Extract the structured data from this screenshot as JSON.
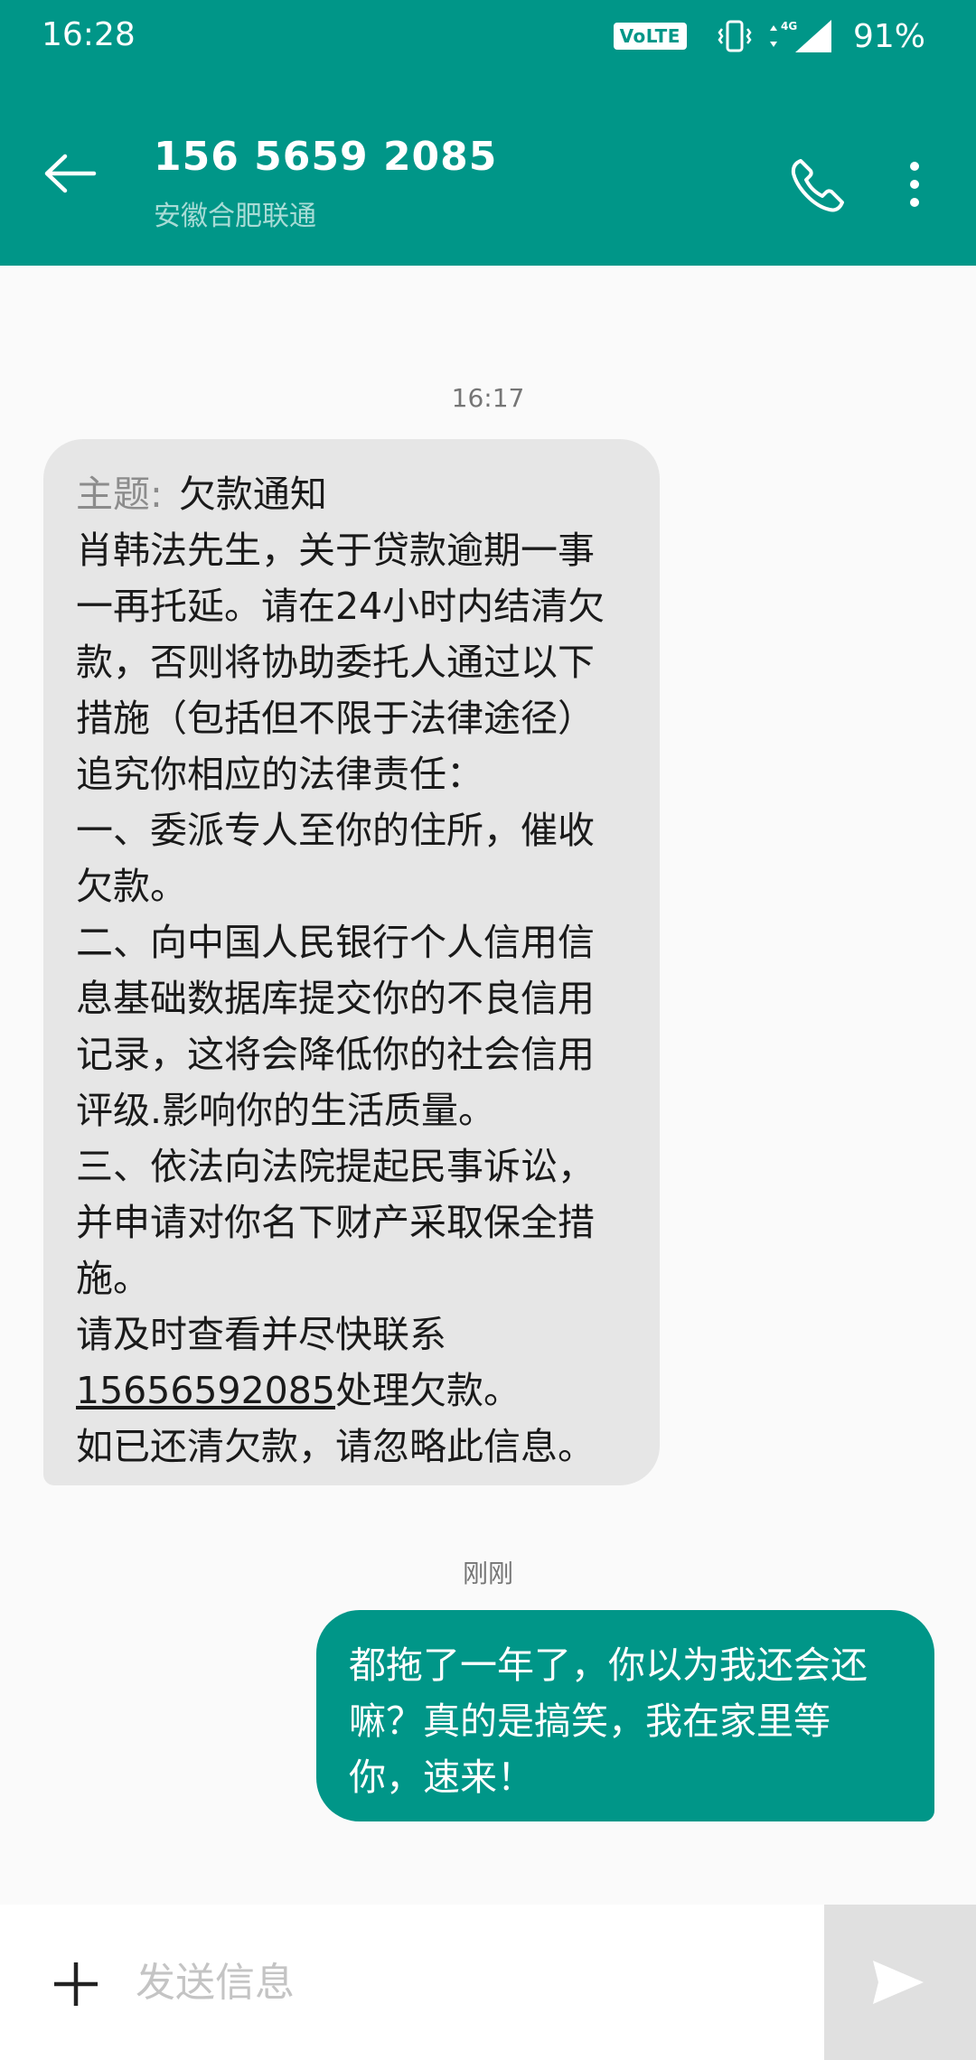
{
  "status_bar": {
    "time": "16:28",
    "volte_label": "VoLTE",
    "network_label": "4G",
    "battery": "91%"
  },
  "header": {
    "contact_name": "156 5659 2085",
    "contact_location": "安徽合肥联通"
  },
  "conversation": {
    "incoming": {
      "timestamp": "16:17",
      "subject_label": "主题:",
      "subject": "欠款通知",
      "lines": [
        "肖韩法先生，关于贷款逾期一事",
        "一再托延。请在24小时内结清欠",
        "款，否则将协助委托人通过以下",
        "措施（包括但不限于法律途径）",
        "追究你相应的法律责任：",
        "一、委派专人至你的住所，催收",
        "欠款。",
        "二、向中国人民银行个人信用信",
        "息基础数据库提交你的不良信用",
        "记录，这将会降低你的社会信用",
        "评级.影响你的生活质量。",
        "三、依法向法院提起民事诉讼，",
        "并申请对你名下财产采取保全措",
        "施。",
        "请及时查看并尽快联系"
      ],
      "phone_link": "15656592085",
      "after_link": "处理欠款。",
      "last_line": "如已还清欠款，请忽略此信息。"
    },
    "outgoing": {
      "timestamp": "刚刚",
      "lines": [
        "都拖了一年了，你以为我还会还",
        "嘛？真的是搞笑，我在家里等",
        "你，速来！"
      ]
    }
  },
  "compose": {
    "placeholder": "发送信息"
  },
  "colors": {
    "primary": "#009688",
    "incoming_bubble": "#e6e6e6",
    "send_area": "#e0e0e0"
  },
  "icons": [
    "back-arrow-icon",
    "phone-icon",
    "more-vert-icon",
    "add-icon",
    "send-icon",
    "vibrate-icon",
    "signal-icon"
  ]
}
